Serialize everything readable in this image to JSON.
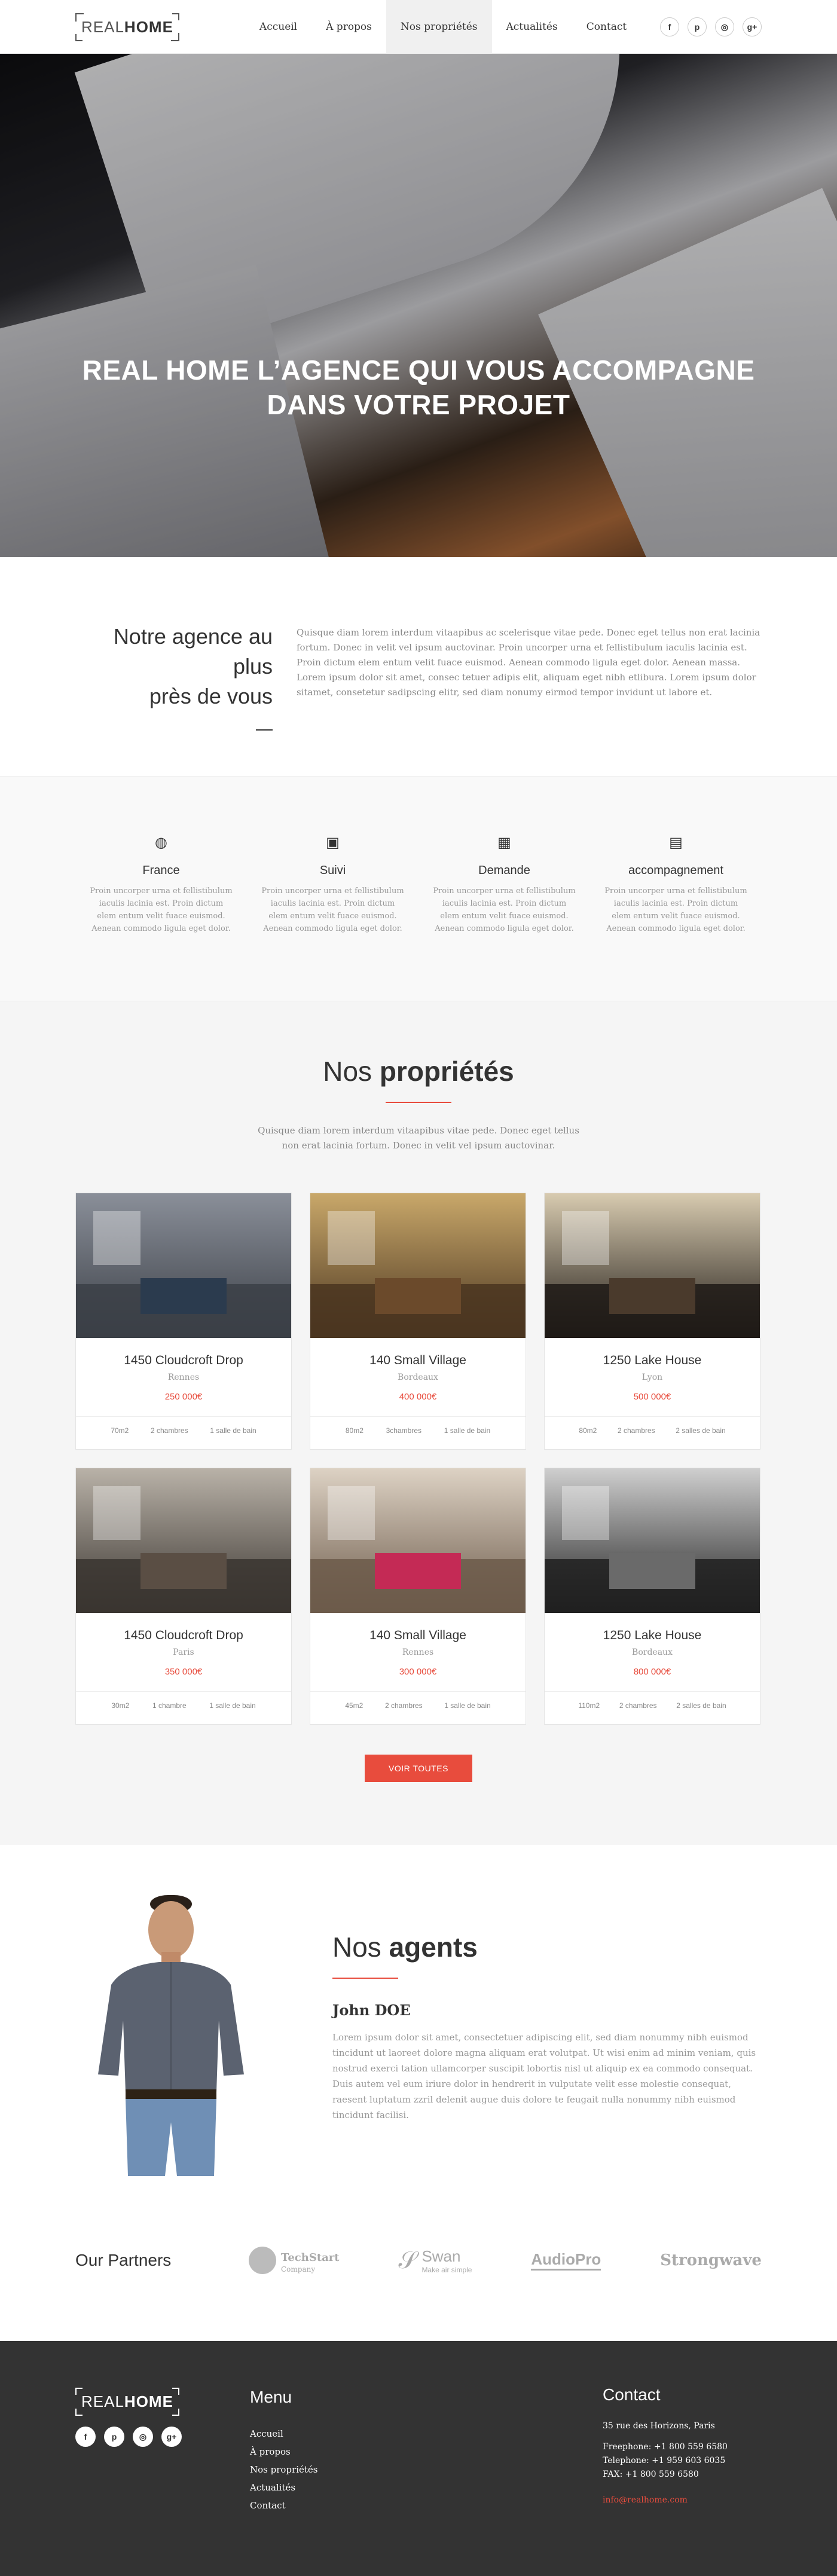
{
  "header": {
    "logo_light": "REAL",
    "logo_bold": "HOME",
    "nav": [
      "Accueil",
      "À propos",
      "Nos propriétés",
      "Actualités",
      "Contact"
    ],
    "social": [
      "f",
      "p",
      "◎",
      "g+"
    ]
  },
  "hero": {
    "title_line1": "REAL HOME L’AGENCE QUI VOUS ACCOMPAGNE",
    "title_line2": "DANS VOTRE PROJET"
  },
  "intro": {
    "title_line1": "Notre agence au plus",
    "title_line2": "près de vous",
    "text": "Quisque diam lorem interdum vitaapibus ac scelerisque vitae pede. Donec eget tellus non erat lacinia fortum. Donec in velit vel ipsum auctovinar. Proin uncorper urna et fellistibulum iaculis lacinia est. Proin dictum elem entum velit fuace euismod. Aenean commodo ligula eget dolor. Aenean massa. Lorem ipsum dolor sit amet, consec tetuer adipis elit, aliquam eget nibh etlibura. Lorem ipsum dolor sitamet, consetetur sadipscing elitr, sed diam nonumy eirmod tempor invidunt ut labore et."
  },
  "features": [
    {
      "icon": "globe-icon",
      "glyph": "◍",
      "title": "France",
      "text": "Proin uncorper urna et fellistibulum iaculis lacinia est. Proin dictum elem entum velit fuace euismod. Aenean commodo ligula eget dolor."
    },
    {
      "icon": "briefcase-icon",
      "glyph": "▣",
      "title": "Suivi",
      "text": "Proin uncorper urna et fellistibulum iaculis lacinia est. Proin dictum elem entum velit fuace euismod. Aenean commodo ligula eget dolor."
    },
    {
      "icon": "image-icon",
      "glyph": "▦",
      "title": "Demande",
      "text": "Proin uncorper urna et fellistibulum iaculis lacinia est. Proin dictum elem entum velit fuace euismod. Aenean commodo ligula eget dolor."
    },
    {
      "icon": "inbox-icon",
      "glyph": "▤",
      "title": "accompagnement",
      "text": "Proin uncorper urna et fellistibulum iaculis lacinia est. Proin dictum elem entum velit fuace euismod. Aenean commodo ligula eget dolor."
    }
  ],
  "properties": {
    "title_light": "Nos ",
    "title_bold": "propriétés",
    "subtitle": "Quisque diam lorem interdum vitaapibus vitae pede. Donec eget tellus non erat lacinia fortum. Donec in velit vel ipsum auctovinar.",
    "items": [
      {
        "name": "1450 Cloudcroft Drop",
        "city": "Rennes",
        "price": "250 000€",
        "area": "70m2",
        "rooms": "2 chambres",
        "baths": "1 salle de bain",
        "c1": "#3b3f46",
        "c2": "#8a8f99",
        "c3": "#2b3b4e"
      },
      {
        "name": "140 Small Village",
        "city": "Bordeaux",
        "price": "400 000€",
        "area": "80m2",
        "rooms": "3chambres",
        "baths": "1 salle de bain",
        "c1": "#4a3520",
        "c2": "#c9a86a",
        "c3": "#6b4a2b"
      },
      {
        "name": "1250 Lake House",
        "city": "Lyon",
        "price": "500 000€",
        "area": "80m2",
        "rooms": "2 chambres",
        "baths": "2 salles de bain",
        "c1": "#1f1a16",
        "c2": "#d8cbb0",
        "c3": "#4a3a2c"
      },
      {
        "name": "1450 Cloudcroft Drop",
        "city": "Paris",
        "price": "350 000€",
        "area": "30m2",
        "rooms": "1 chambre",
        "baths": "1 salle de bain",
        "c1": "#3a3530",
        "c2": "#b9b2a8",
        "c3": "#5a4e44"
      },
      {
        "name": "140 Small Village",
        "city": "Rennes",
        "price": "300 000€",
        "area": "45m2",
        "rooms": "2 chambres",
        "baths": "1 salle de bain",
        "c1": "#6c5a4a",
        "c2": "#ddd2c4",
        "c3": "#c42a55"
      },
      {
        "name": "1250 Lake House",
        "city": "Bordeaux",
        "price": "800 000€",
        "area": "110m2",
        "rooms": "2 chambres",
        "baths": "2 salles de bain",
        "c1": "#202020",
        "c2": "#cfcfcf",
        "c3": "#6a6a6a"
      }
    ],
    "button": "VOIR TOUTES"
  },
  "agents": {
    "title_light": "Nos ",
    "title_bold": "agents",
    "name": "John DOE",
    "text": "Lorem ipsum dolor sit amet, consectetuer adipiscing elit, sed diam nonummy nibh euismod tincidunt ut laoreet dolore magna aliquam erat volutpat. Ut wisi enim ad minim veniam, quis nostrud exerci tation ullamcorper suscipit lobortis nisl ut aliquip ex ea commodo consequat. Duis autem vel eum iriure dolor in hendrerit in vulputate velit esse molestie consequat, raesent luptatum zzril delenit augue duis dolore te feugait nulla nonummy nibh euismod tincidunt facilisi."
  },
  "partners": {
    "title_light": "Our ",
    "title_normal": "Partners",
    "logos": [
      {
        "name": "TechStart",
        "sub": "Company"
      },
      {
        "name": "Swan",
        "sub": "Make air simple"
      },
      {
        "name": "AudioPro",
        "sub": ""
      },
      {
        "name": "Strongwave",
        "sub": ""
      }
    ]
  },
  "footer": {
    "logo_light": "REAL",
    "logo_bold": "HOME",
    "social": [
      "f",
      "p",
      "◎",
      "g+"
    ],
    "menu_title": "Menu",
    "menu": [
      "Accueil",
      "À propos",
      "Nos propriétés",
      "Actualités",
      "Contact"
    ],
    "contact_title": "Contact",
    "address": "35 rue des Horizons, Paris",
    "phone1": "Freephone: +1 800 559 6580",
    "phone2": "Telephone: +1 959 603 6035",
    "fax": "FAX: +1 800 559 6580",
    "email": "info@realhome.com"
  },
  "colors": {
    "accent": "#e84c3d",
    "footer_bg": "#333333",
    "section_bg": "#f5f5f5"
  }
}
